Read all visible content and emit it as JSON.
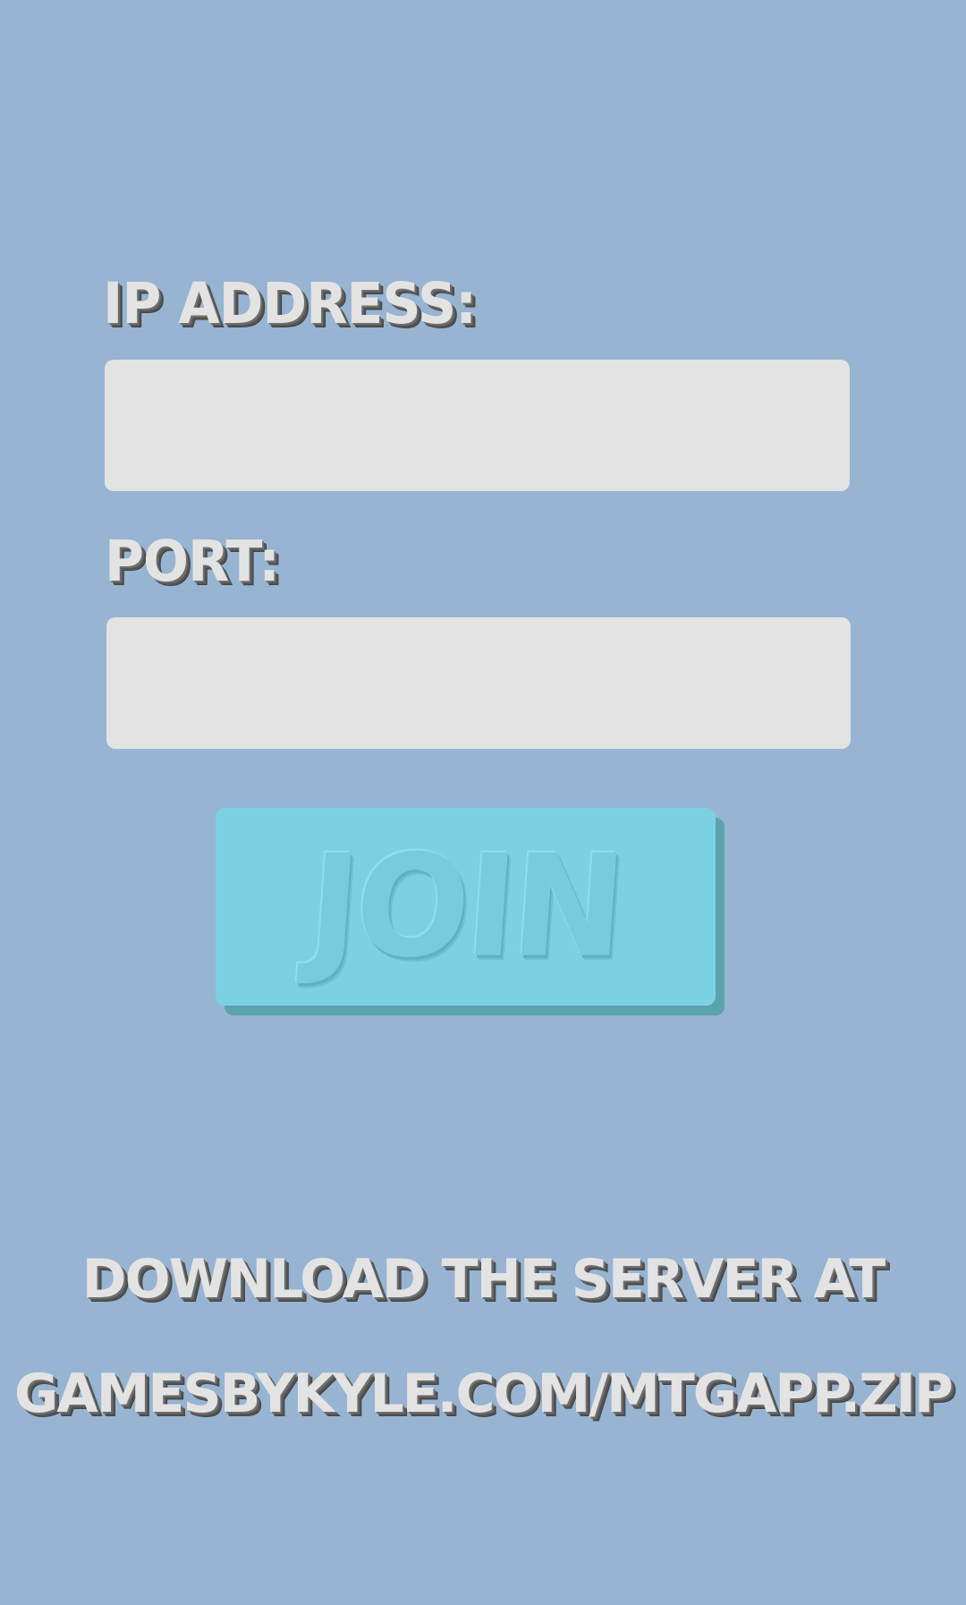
{
  "form": {
    "ip_label": "IP ADDRESS:",
    "ip_value": "",
    "ip_placeholder": "",
    "port_label": "PORT:",
    "port_value": "",
    "port_placeholder": "",
    "join_label": "JOIN"
  },
  "footer": {
    "line1": "DOWNLOAD THE SERVER AT",
    "line2": "GAMESBYKYLE.COM/MTGAPP.ZIP"
  },
  "colors": {
    "background": "#97b4d2",
    "field": "#e3e3e3",
    "button": "#7bd1e2",
    "button_shadow": "#5aa2ad",
    "label_text": "#e3e3e3"
  }
}
